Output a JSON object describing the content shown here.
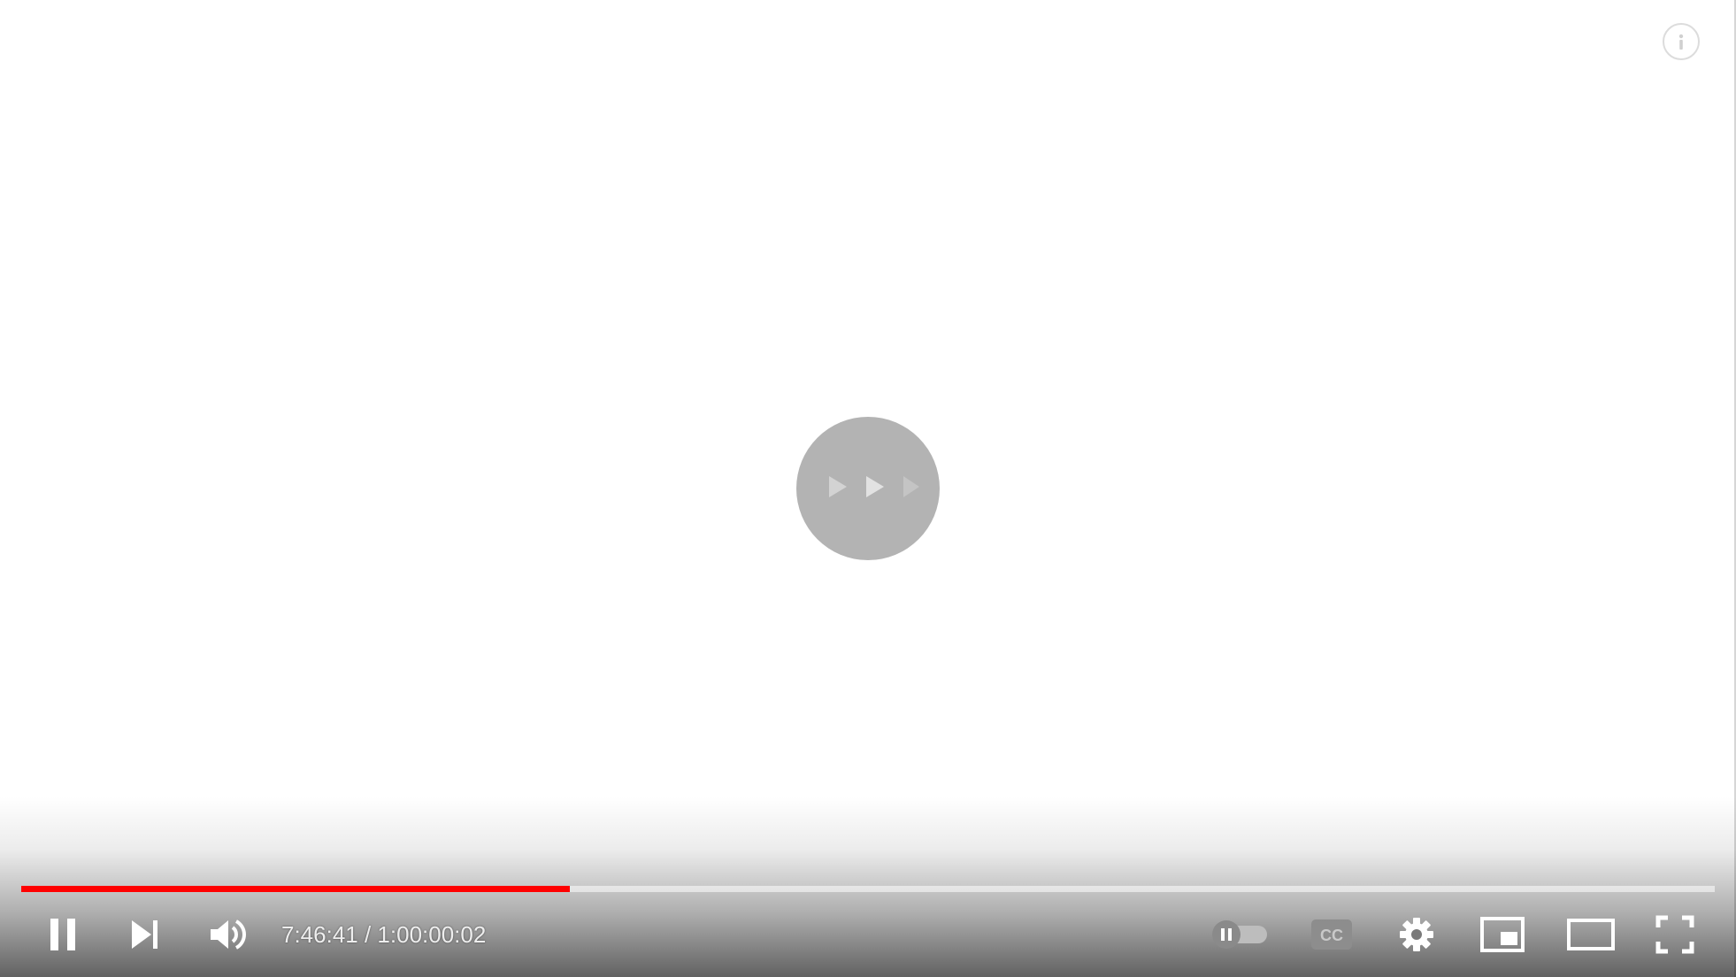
{
  "player": {
    "progress_fraction": 0.3237,
    "colors": {
      "progress_played": "#ff0000",
      "control_icon": "#ffffff",
      "spinner_bg": "#b3b3b3"
    }
  },
  "time": {
    "current": "7:46:41",
    "separator": " / ",
    "duration": "1:00:00:02"
  },
  "icons": {
    "info": "info-icon",
    "spinner": "loading-arrows-icon",
    "pause": "pause-icon",
    "next": "skip-next-icon",
    "volume": "volume-icon",
    "autoplay": "autoplay-toggle-icon",
    "captions": "captions-icon",
    "settings": "gear-icon",
    "miniplayer": "miniplayer-icon",
    "theater": "theater-mode-icon",
    "fullscreen": "fullscreen-icon"
  }
}
